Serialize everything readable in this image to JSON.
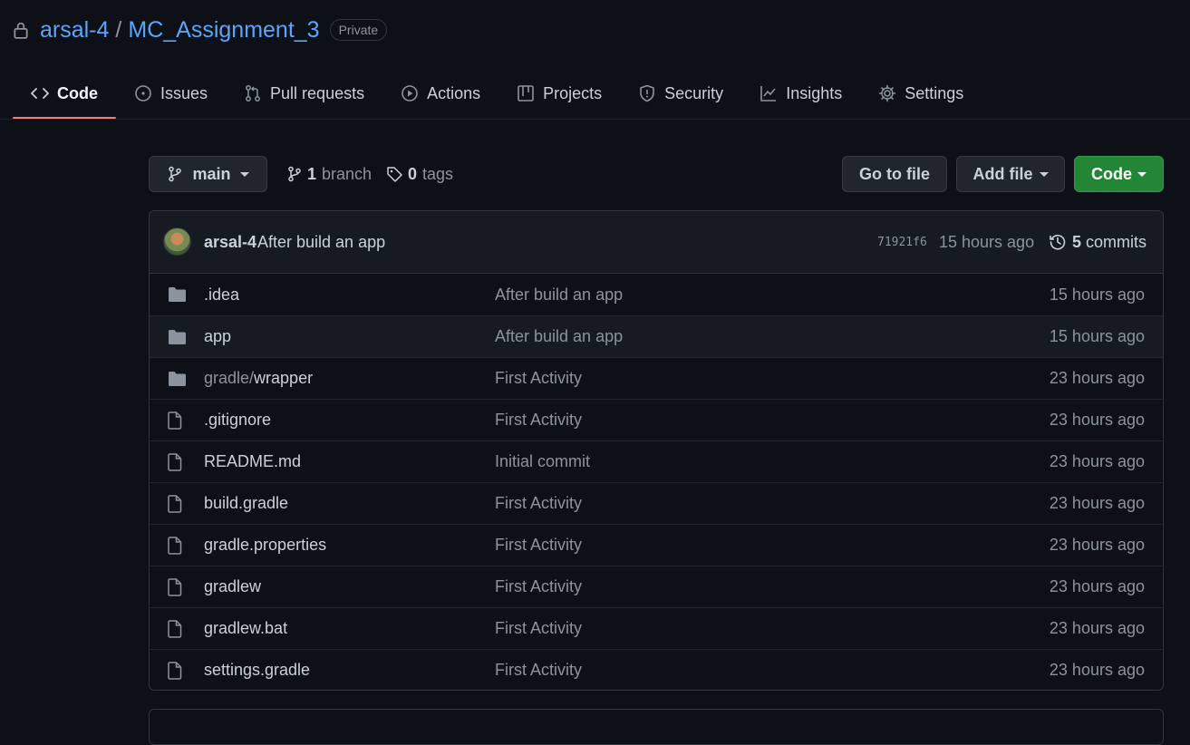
{
  "repo": {
    "owner": "arsal-4",
    "separator": "/",
    "name": "MC_Assignment_3",
    "visibility": "Private"
  },
  "tabs": [
    {
      "label": "Code",
      "icon": "code-icon",
      "active": true
    },
    {
      "label": "Issues",
      "icon": "issue-opened-icon"
    },
    {
      "label": "Pull requests",
      "icon": "git-pull-request-icon"
    },
    {
      "label": "Actions",
      "icon": "play-icon"
    },
    {
      "label": "Projects",
      "icon": "table-icon"
    },
    {
      "label": "Security",
      "icon": "shield-icon"
    },
    {
      "label": "Insights",
      "icon": "graph-icon"
    },
    {
      "label": "Settings",
      "icon": "gear-icon"
    }
  ],
  "toolbar": {
    "branch_name": "main",
    "branch_count": "1",
    "branch_label": "branch",
    "tag_count": "0",
    "tag_label": "tags",
    "goto_label": "Go to file",
    "add_label": "Add file",
    "code_label": "Code"
  },
  "latest_commit": {
    "author": "arsal-4",
    "message": "After build an app",
    "sha": "71921f6",
    "time": "15 hours ago",
    "count": "5",
    "count_label": "commits"
  },
  "files": [
    {
      "type": "dir",
      "name": ".idea",
      "message": "After build an app",
      "time": "15 hours ago"
    },
    {
      "type": "dir",
      "name": "app",
      "message": "After build an app",
      "time": "15 hours ago"
    },
    {
      "type": "dir",
      "name_prefix": "gradle/",
      "name": "wrapper",
      "message": "First Activity",
      "time": "23 hours ago"
    },
    {
      "type": "file",
      "name": ".gitignore",
      "message": "First Activity",
      "time": "23 hours ago"
    },
    {
      "type": "file",
      "name": "README.md",
      "message": "Initial commit",
      "time": "23 hours ago"
    },
    {
      "type": "file",
      "name": "build.gradle",
      "message": "First Activity",
      "time": "23 hours ago"
    },
    {
      "type": "file",
      "name": "gradle.properties",
      "message": "First Activity",
      "time": "23 hours ago"
    },
    {
      "type": "file",
      "name": "gradlew",
      "message": "First Activity",
      "time": "23 hours ago"
    },
    {
      "type": "file",
      "name": "gradlew.bat",
      "message": "First Activity",
      "time": "23 hours ago"
    },
    {
      "type": "file",
      "name": "settings.gradle",
      "message": "First Activity",
      "time": "23 hours ago"
    }
  ],
  "colors": {
    "background": "#0d1117",
    "link": "#58a6ff",
    "muted": "#8b949e",
    "active_tab_underline": "#f78166",
    "code_button": "#238636"
  }
}
